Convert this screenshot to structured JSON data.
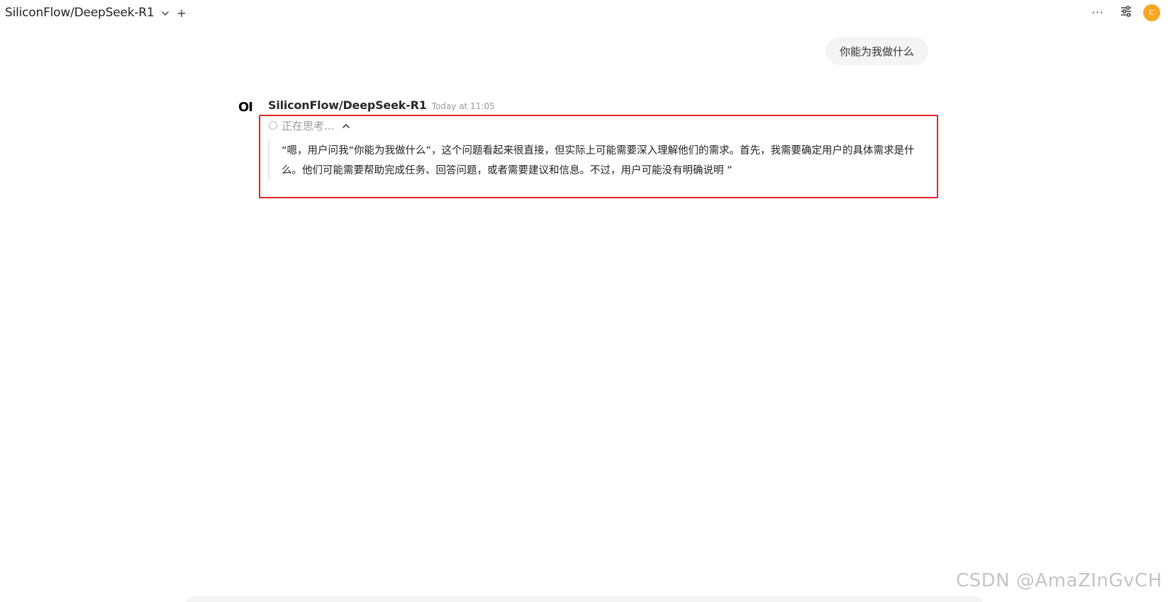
{
  "header": {
    "model_name": "SiliconFlow/DeepSeek-R1",
    "icons": {
      "model_dropdown": "chevron-down-icon",
      "new_model": "plus-icon",
      "more": "ellipsis-icon",
      "controls": "sliders-icon"
    },
    "plus_label": "+",
    "more_label": "···",
    "avatar_initial": "C",
    "avatar_color": "#f5a623"
  },
  "messages": {
    "user": {
      "text": "你能为我做什么"
    },
    "assistant": {
      "logo_text": "OI",
      "name": "SiliconFlow/DeepSeek-R1",
      "timestamp": "Today at 11:05",
      "thinking_label": "正在思考...",
      "reasoning": "“嗯，用户问我“你能为我做什么”，这个问题看起来很直接，但实际上可能需要深入理解他们的需求。首先，我需要确定用户的具体需求是什么。他们可能需要帮助完成任务、回答问题，或者需要建议和信息。不过，用户可能没有明确说明 ”",
      "highlight_color": "#e02424"
    }
  },
  "watermark": "CSDN @AmaZInGvCH"
}
